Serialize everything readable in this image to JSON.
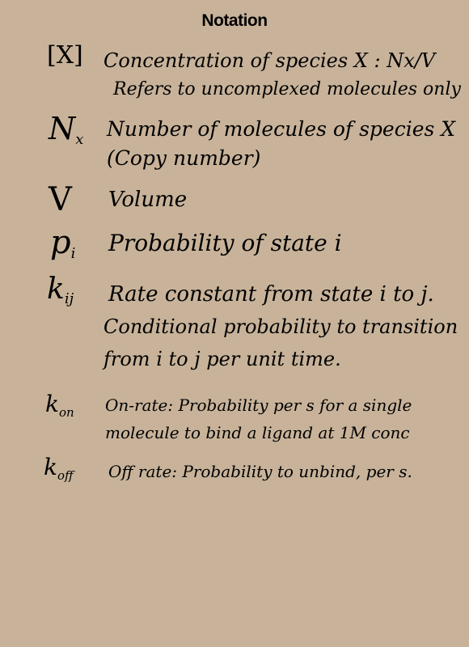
{
  "title": "Notation",
  "entries": [
    {
      "symbol": "[X]",
      "symbol_sub": "",
      "lines": [
        "Concentration of species X : Nx/V",
        "Refers to uncomplexed molecules only"
      ]
    },
    {
      "symbol": "N",
      "symbol_sub": "x",
      "lines": [
        "Number of molecules of species X",
        "(Copy number)"
      ]
    },
    {
      "symbol": "V",
      "symbol_sub": "",
      "lines": [
        "Volume"
      ]
    },
    {
      "symbol": "p",
      "symbol_sub": "i",
      "lines": [
        "Probability of state i"
      ]
    },
    {
      "symbol": "k",
      "symbol_sub": "ij",
      "lines": [
        "Rate constant from state i to j.",
        "Conditional probability to transition",
        "from i to j per unit time."
      ]
    },
    {
      "symbol": "k",
      "symbol_sub": "on",
      "lines": [
        "On-rate: Probability per s for a single",
        "molecule to bind a ligand at 1M conc"
      ]
    },
    {
      "symbol": "k",
      "symbol_sub": "off",
      "lines": [
        "Off rate: Probability to unbind, per s."
      ]
    }
  ]
}
